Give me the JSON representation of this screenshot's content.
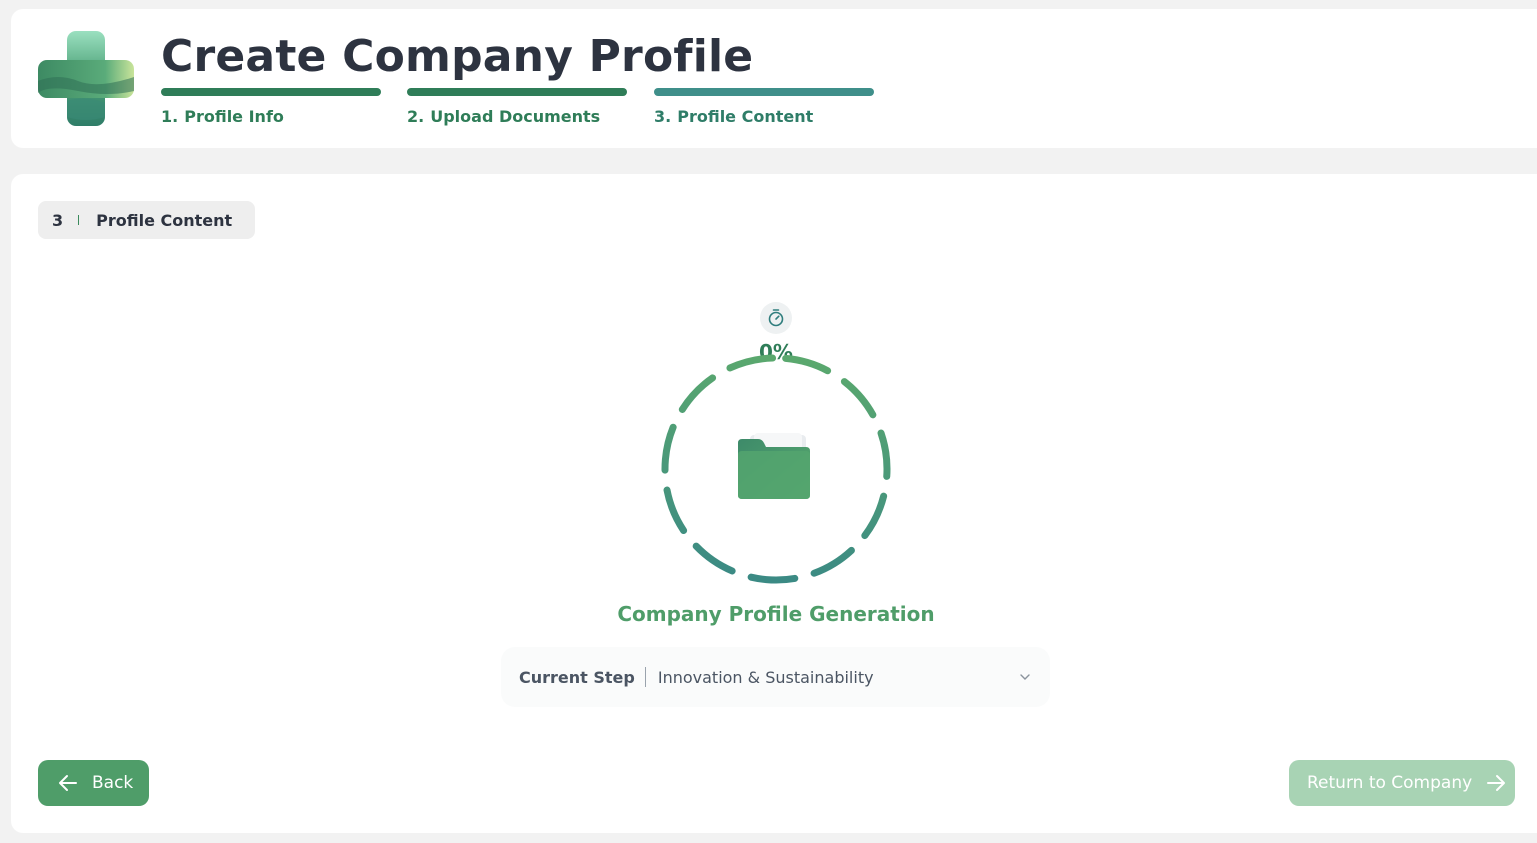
{
  "header": {
    "title": "Create Company Profile",
    "steps": [
      {
        "number": "1.",
        "label": "Profile Info",
        "color": "#2f7d58",
        "status": "complete"
      },
      {
        "number": "2.",
        "label": "Upload Documents",
        "color": "#2f7d58",
        "status": "complete"
      },
      {
        "number": "3.",
        "label": "Profile Content",
        "color": "#3f8f8a",
        "status": "current"
      }
    ]
  },
  "section": {
    "number": "3",
    "title": "Profile Content"
  },
  "progress": {
    "percent_label": "0%",
    "percent_value": 0,
    "title": "Company Profile Generation",
    "current_step_label": "Current Step",
    "current_step_value": "Innovation & Sustainability"
  },
  "actions": {
    "back_label": "Back",
    "return_label": "Return to Company"
  },
  "icons": {
    "logo": "plus-landscape-logo",
    "timer": "stopwatch-icon",
    "folder": "folder-icon",
    "chevron": "chevron-down-icon",
    "back": "arrow-left-icon",
    "forward": "arrow-right-icon"
  },
  "colors": {
    "primary": "#4f9d69",
    "primary_dark": "#2f7d58",
    "teal": "#3f8f8a",
    "disabled": "#a8d3b4",
    "title_text": "#2d3340"
  }
}
